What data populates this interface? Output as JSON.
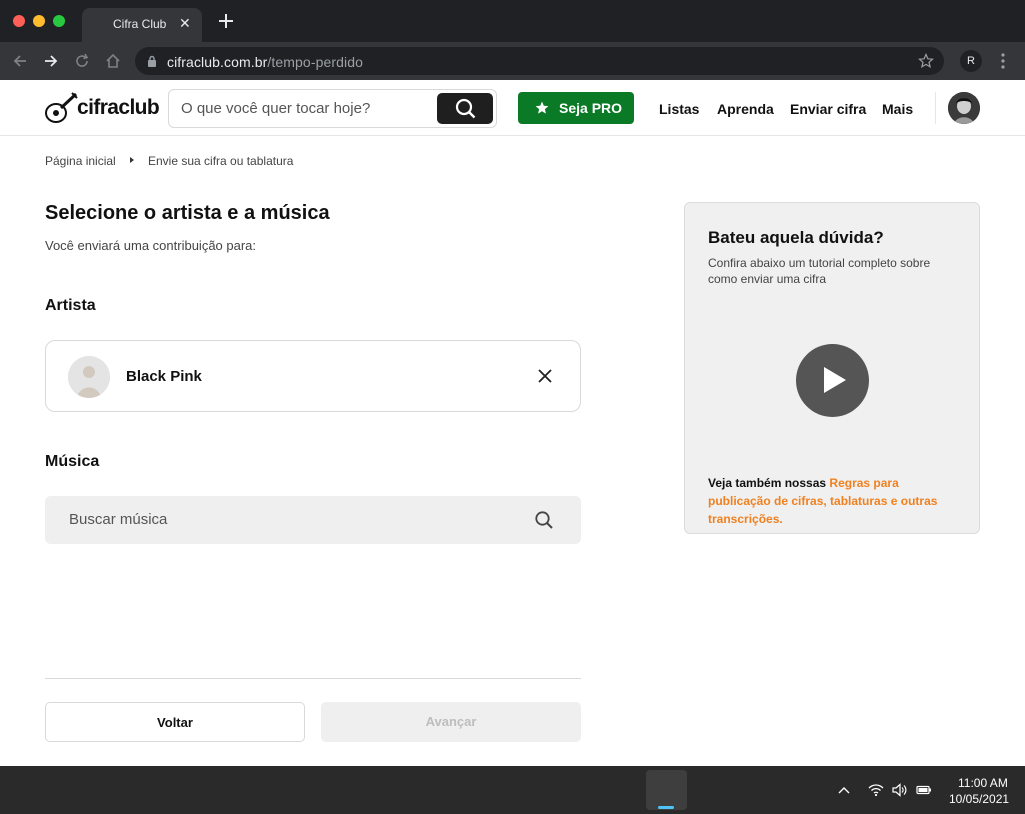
{
  "browser": {
    "tab_title": "Cifra Club",
    "tab_close": "✕",
    "url_host": "cifraclub.com.br",
    "url_path": "/tempo-perdido",
    "profile_initial": "R"
  },
  "header": {
    "logo_text": "cifraclub",
    "search_placeholder": "O que você quer tocar hoje?",
    "pro_label": "Seja PRO",
    "nav": [
      "Listas",
      "Aprenda",
      "Enviar cifra",
      "Mais"
    ]
  },
  "breadcrumb": {
    "home": "Página inicial",
    "current": "Envie sua cifra ou tablatura"
  },
  "form": {
    "title": "Selecione o artista e a música",
    "subtitle": "Você enviará uma contribuição para:",
    "artist_label": "Artista",
    "artist_name": "Black Pink",
    "music_label": "Música",
    "music_placeholder": "Buscar música",
    "back_label": "Voltar",
    "next_label": "Avançar"
  },
  "help": {
    "title": "Bateu aquela dúvida?",
    "description": "Confira abaixo um tutorial completo sobre como enviar uma cifra",
    "footer_prefix": "Veja também nossas ",
    "footer_link": "Regras para publicação de cifras, tablaturas e outras transcrições."
  },
  "taskbar": {
    "time": "11:00 AM",
    "date": "10/05/2021"
  },
  "colors": {
    "pro_green": "#0a7a26",
    "link_orange": "#f08121",
    "chrome_dark": "#202124"
  }
}
